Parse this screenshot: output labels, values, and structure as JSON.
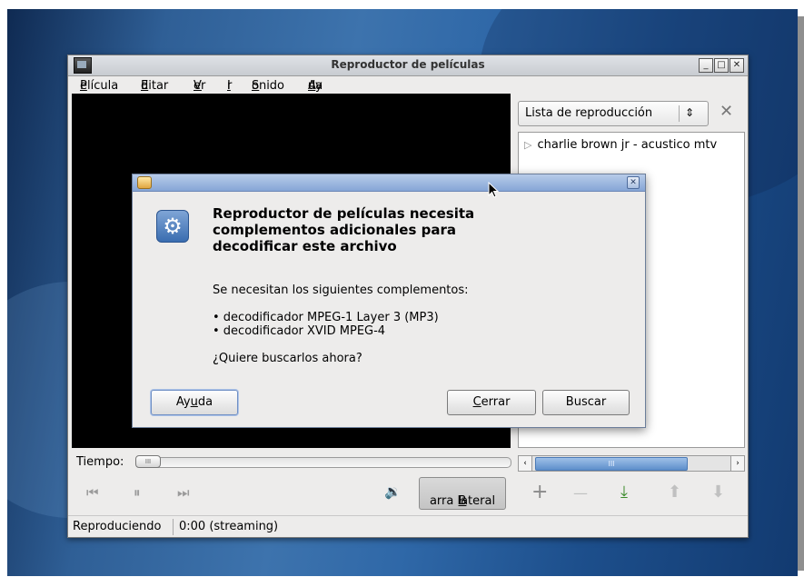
{
  "window": {
    "title": "Reproductor de películas",
    "controls": [
      "_",
      "□",
      "✕"
    ]
  },
  "menu": {
    "items": [
      {
        "pre": "",
        "u": "P",
        "post": "elícula"
      },
      {
        "pre": "",
        "u": "E",
        "post": "ditar"
      },
      {
        "pre": "",
        "u": "V",
        "post": "er"
      },
      {
        "pre": "",
        "u": "I",
        "post": "r"
      },
      {
        "pre": "",
        "u": "S",
        "post": "onido"
      },
      {
        "pre": "Ay",
        "u": "u",
        "post": "da"
      }
    ]
  },
  "sidebar": {
    "combo_label": "Lista de reproducción",
    "combo_arrow": "⇕",
    "close": "✕",
    "playlist": [
      "charlie brown jr - acustico mtv"
    ],
    "scroll_thumb_grip": "III"
  },
  "controls": {
    "time_label": "Tiempo:",
    "seek_grip": "III",
    "prev": "⏮",
    "pause": "⏸",
    "next": "⏭",
    "volume_icon": "🔉",
    "sidebar_button": {
      "u": "B",
      "post": "arra lateral"
    },
    "add": "+",
    "remove": "—",
    "save": "⤓",
    "up": "⬆",
    "down": "⬇"
  },
  "status": {
    "state": "Reproduciendo",
    "time": "0:00 (streaming)"
  },
  "dialog": {
    "headline": "Reproductor de películas necesita complementos adicionales para decodificar este archivo",
    "message": "Se necesitan los siguientes complementos:",
    "plugins": [
      "• decodificador MPEG-1 Layer 3 (MP3)",
      "• decodificador XVID MPEG-4"
    ],
    "question": "¿Quiere buscarlos ahora?",
    "help_button": {
      "pre": "Ay",
      "u": "u",
      "post": "da"
    },
    "close_button": {
      "pre": "",
      "u": "C",
      "post": "errar"
    },
    "search_button": "Buscar",
    "close_icon": "✕"
  },
  "colors": {
    "dialog_title": "#86a6d6",
    "video_bg": "#000000",
    "scroll_thumb": "#5e8fcb"
  }
}
